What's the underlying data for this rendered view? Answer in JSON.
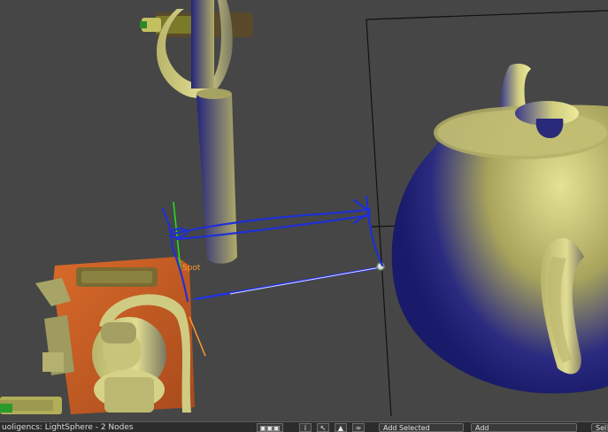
{
  "viewport": {
    "light_label": "Spot"
  },
  "statusbar": {
    "selection_info": "uoligencs: LightSphere - 2 Nodes",
    "icons": [
      "grid-icon",
      "info-icon",
      "arrow-left-icon",
      "lock-icon",
      "link-icon"
    ],
    "add_selected_label": "Add Selected",
    "add_label": "Add",
    "more_label": "Sel"
  },
  "colors": {
    "background": "#464646",
    "teapot_yellow": "#c8c46a",
    "teapot_blue": "#1a1a7a",
    "annotation_blue": "#1f2fd6",
    "light_orange": "#ff9a2a",
    "green_axis": "#22dd22"
  }
}
